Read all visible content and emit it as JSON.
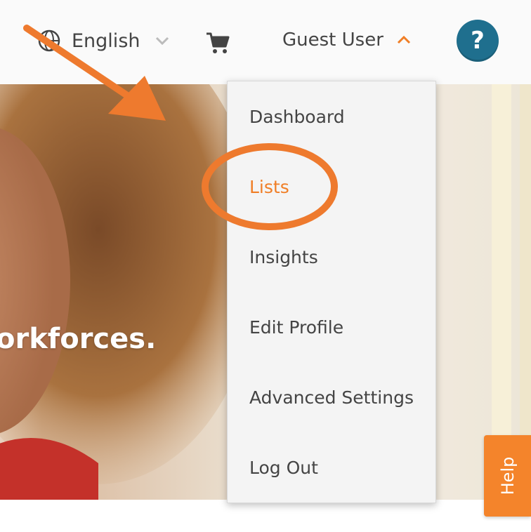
{
  "header": {
    "language": "English",
    "user_name": "Guest User",
    "help_symbol": "?"
  },
  "hero": {
    "tagline": "orkforces."
  },
  "user_menu": {
    "items": [
      {
        "label": "Dashboard",
        "active": false
      },
      {
        "label": "Lists",
        "active": true
      },
      {
        "label": "Insights",
        "active": false
      },
      {
        "label": "Edit Profile",
        "active": false
      },
      {
        "label": "Advanced Settings",
        "active": false
      },
      {
        "label": "Log Out",
        "active": false
      }
    ]
  },
  "help_tab": {
    "label": "Help"
  },
  "colors": {
    "accent": "#f07e26",
    "help_circle": "#1f6f8e",
    "help_tab": "#f4842b"
  },
  "icons": {
    "language": "globe-icon",
    "language_toggle": "chevron-down-icon",
    "cart": "cart-icon",
    "user_toggle": "chevron-up-icon"
  }
}
